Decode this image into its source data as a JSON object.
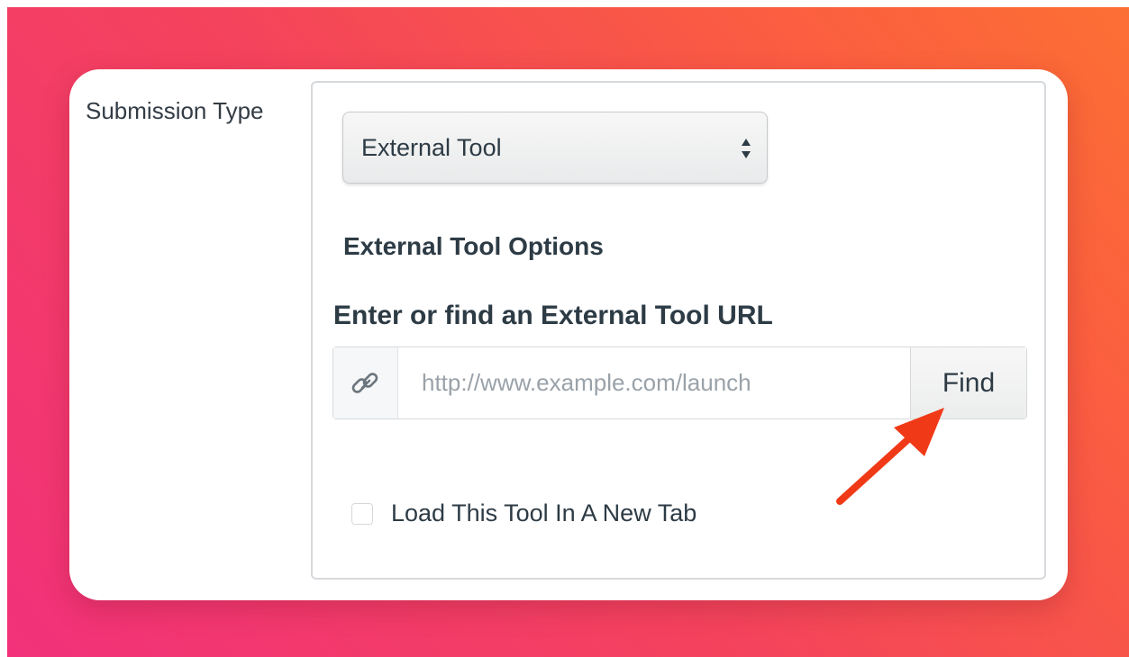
{
  "form": {
    "submission_type_label": "Submission Type",
    "submission_type_value": "External Tool",
    "options_title": "External Tool Options",
    "url_label": "Enter or find an External Tool URL",
    "url_input": {
      "value": "",
      "placeholder": "http://www.example.com/launch"
    },
    "find_label": "Find",
    "new_tab_checkbox": {
      "label": "Load This Tool In A New Tab",
      "checked": false
    }
  },
  "icons": {
    "link": "link-icon",
    "select_arrows": "select-arrows-icon",
    "annotation": "red-arrow-icon"
  },
  "colors": {
    "background_gradient_start": "#f2317a",
    "background_gradient_end": "#fc6f34",
    "text": "#2d3b45",
    "placeholder": "#9aa2a9",
    "annotation_arrow": "#f03a17"
  }
}
